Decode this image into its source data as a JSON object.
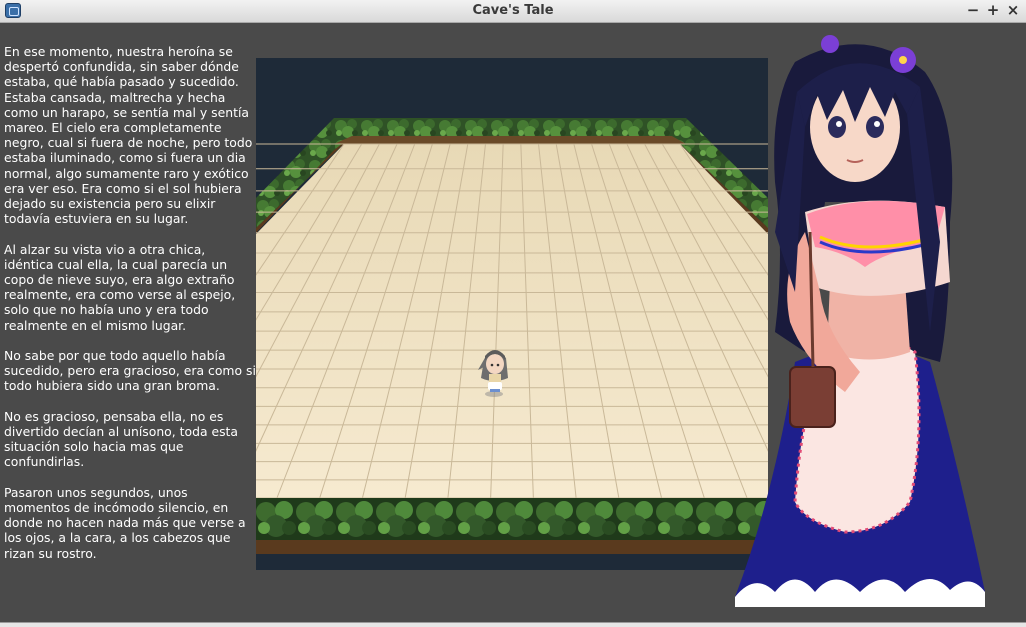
{
  "window": {
    "title": "Cave's Tale",
    "app_icon": "game-window-icon",
    "buttons": [
      {
        "name": "minimize-button",
        "glyph": "−",
        "icon": "minimize-icon"
      },
      {
        "name": "maximize-button",
        "glyph": "+",
        "icon": "maximize-icon"
      },
      {
        "name": "close-button",
        "glyph": "×",
        "icon": "close-icon"
      }
    ]
  },
  "story": {
    "paragraphs": [
      "En ese momento, nuestra heroína se despertó confundida, sin saber dónde estaba, qué había pasado y sucedido. Estaba cansada, maltrecha y hecha como un harapo, se sentía mal y sentía mareo. El cielo era completamente negro, cual si fuera de noche, pero todo estaba iluminado, como si fuera un dia normal, algo sumamente raro y exótico era ver eso. Era como si el sol hubiera dejado su existencia pero su elixir todavía estuviera en su lugar.",
      "Al alzar su vista vio a otra chica, idéntica cual ella, la cual parecía un copo de nieve suyo, era algo extraño realmente, era como verse al espejo, solo que no había uno y era todo realmente en el mismo lugar.",
      "No sabe por que todo aquello había sucedido, pero era gracioso, era como si todo hubiera sido una gran broma.",
      "No es gracioso, pensaba ella, no es divertido decían al unísono, toda esta situación solo hacia mas que confundirlas.",
      "Pasaron unos segundos, unos momentos de incómodo silencio, en donde no hacen nada más que verse a los ojos, a la cara, a los cabezos que rizan su rostro."
    ]
  },
  "colors": {
    "background": "#4a4a4a",
    "void": "#1e2a38",
    "floor": "#f3e6c8",
    "grid": "#c9b898",
    "hedge": "#355a2a",
    "text": "#ffffff"
  },
  "scene": {
    "view": "3D perspective room with tiled floor surrounded by hedges",
    "character": "small chibi girl with grey hair standing on floor"
  },
  "portrait": {
    "character": "anime heroine with dark blue hair, pink top, blue skirt and brown satchel"
  }
}
